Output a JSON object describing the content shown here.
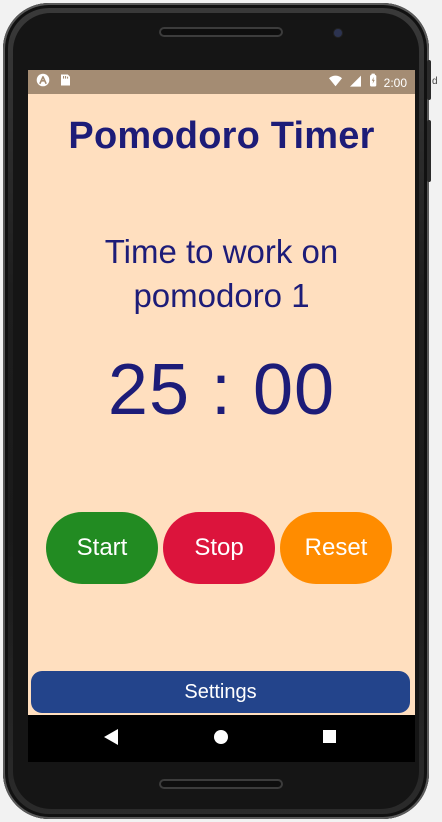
{
  "status_bar": {
    "time": "2:00",
    "icons": {
      "left": [
        "app-icon",
        "sd-card-icon"
      ],
      "right": [
        "wifi-icon",
        "signal-icon",
        "battery-icon"
      ]
    }
  },
  "app": {
    "title": "Pomodoro Timer",
    "session_line_1": "Time to work on",
    "session_line_2": "pomodoro 1",
    "timer": "25 : 00",
    "buttons": {
      "start": "Start",
      "stop": "Stop",
      "reset": "Reset",
      "settings": "Settings"
    },
    "colors": {
      "background": "#ffdfbf",
      "text": "#1d1c78",
      "start": "#228b22",
      "stop": "#dc143c",
      "reset": "#ff8c00",
      "settings": "#23448b"
    }
  },
  "system_nav": {
    "icons": [
      "back-icon",
      "home-icon",
      "recents-icon"
    ]
  },
  "device": {
    "side_mark": "d"
  }
}
